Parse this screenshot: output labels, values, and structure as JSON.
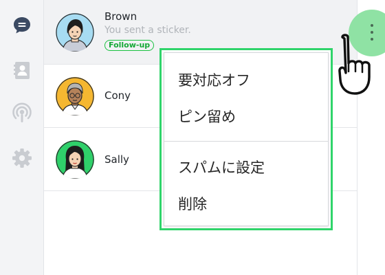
{
  "nav": {
    "items": [
      {
        "id": "chats",
        "icon": "chat-bubble-icon",
        "active": true
      },
      {
        "id": "contacts",
        "icon": "contact-card-icon",
        "active": false
      },
      {
        "id": "broadcast",
        "icon": "broadcast-icon",
        "active": false
      },
      {
        "id": "settings",
        "icon": "gear-icon",
        "active": false
      }
    ]
  },
  "chats": [
    {
      "name": "Brown",
      "preview": "You sent a sticker.",
      "badge": "Follow-up",
      "selected": true
    },
    {
      "name": "Cony",
      "preview": "",
      "badge": ""
    },
    {
      "name": "Sally",
      "preview": "",
      "badge": ""
    }
  ],
  "context_menu": {
    "items": [
      {
        "label": "要対応オフ"
      },
      {
        "label": "ピン留め"
      },
      {
        "label": "スパムに設定"
      },
      {
        "label": "削除"
      }
    ]
  },
  "colors": {
    "accent_green": "#19c13f",
    "menu_highlight": "#2fd46a",
    "more_button_highlight": "#8fe2a4",
    "nav_active": "#3b4a63",
    "nav_inactive": "#c9ccd1"
  }
}
